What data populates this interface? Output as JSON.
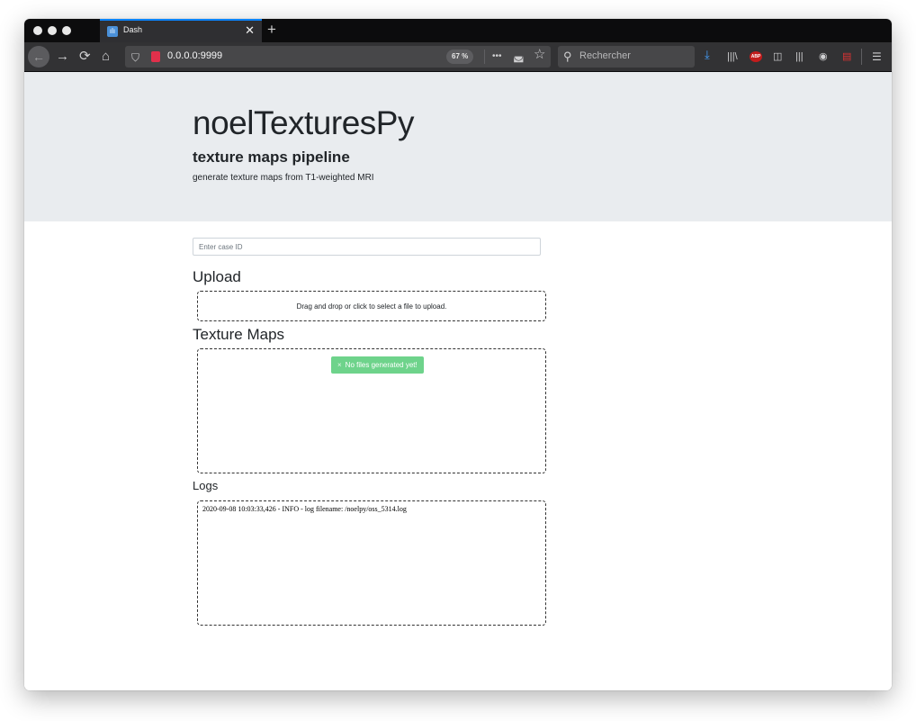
{
  "browser": {
    "tab": {
      "title": "Dash",
      "favicon": "bar-chart-icon"
    },
    "url": "0.0.0.0:9999",
    "zoom": "67 %",
    "search_placeholder": "Rechercher",
    "abp_label": "ABP",
    "icons": {
      "back": "←",
      "forward": "→",
      "reload": "⟳",
      "home": "⌂",
      "shield": "⛉",
      "more": "•••",
      "pocket": "◛",
      "star": "☆",
      "search": "⚲",
      "download": "⤓",
      "library": "|||\\",
      "sidebar": "◫",
      "containers": "|||",
      "account": "◉",
      "pdf": "▤",
      "menu": "☰",
      "close": "✕",
      "new_tab": "+",
      "favicon": "ılı"
    },
    "accent_color": "#0a84ff"
  },
  "page": {
    "title": "noelTexturesPy",
    "subtitle": "texture maps pipeline",
    "description": "generate texture maps from T1-weighted MRI",
    "case_input_placeholder": "Enter case ID",
    "upload_heading": "Upload",
    "upload_prompt": "Drag and drop or click to select a file to upload.",
    "texture_heading": "Texture Maps",
    "no_files_alert": "No files generated yet!",
    "alert_icon": "×",
    "alert_color": "#6ed38b",
    "logs_heading": "Logs",
    "log_lines": [
      "2020-09-08 10:03:33,426 - INFO - log filename: /noelpy/oss_5314.log"
    ]
  }
}
